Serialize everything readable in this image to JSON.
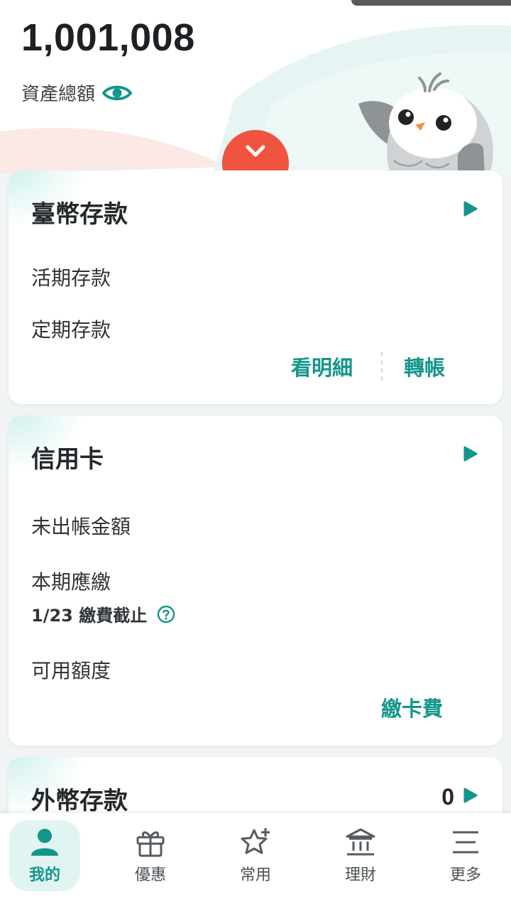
{
  "header": {
    "balance": "1,001,008",
    "total_label": "資產總額"
  },
  "cards": {
    "twd": {
      "title": "臺幣存款",
      "rows": [
        "活期存款",
        "定期存款"
      ],
      "actions": [
        "看明細",
        "轉帳"
      ]
    },
    "credit": {
      "title": "信用卡",
      "unbilled": "未出帳金額",
      "due": "本期應繳",
      "due_note": "1/23 繳費截止",
      "available": "可用額度",
      "action": "繳卡費"
    },
    "fx": {
      "title": "外幣存款",
      "count": "0"
    }
  },
  "tabs": [
    {
      "label": "我的",
      "icon": "person-icon",
      "active": true
    },
    {
      "label": "優惠",
      "icon": "gift-icon",
      "active": false
    },
    {
      "label": "常用",
      "icon": "star-plus-icon",
      "active": false
    },
    {
      "label": "理財",
      "icon": "bank-icon",
      "active": false
    },
    {
      "label": "更多",
      "icon": "menu-icon",
      "active": false
    }
  ],
  "colors": {
    "accent": "#13968a",
    "alert": "#f0533f",
    "background": "#f1f4f4"
  }
}
